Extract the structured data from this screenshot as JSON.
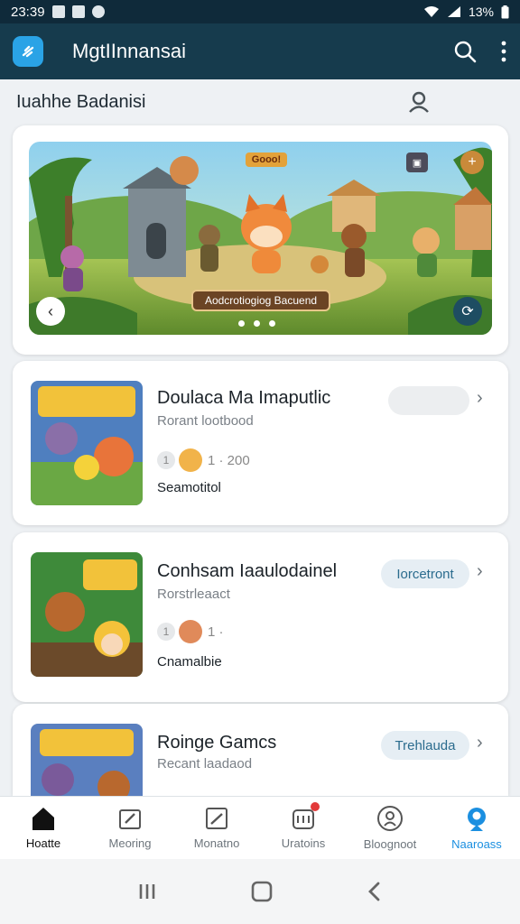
{
  "status_bar": {
    "time": "23:39",
    "battery": "13%"
  },
  "app_bar": {
    "title": "MgtIInnansai"
  },
  "subheader": {
    "title": "Iuahhe  Badanisi"
  },
  "banner": {
    "badge": "Gooo!",
    "label": "Aodcrotiogiog Bacuend",
    "dots": 3
  },
  "games": [
    {
      "title": "Doulaca Ma Imaputlic",
      "subtitle": "Rorant lootbood",
      "counts": "1 · 200",
      "meta": "Seamotitol",
      "action": ""
    },
    {
      "title": "Conhsam Iaaulodainel",
      "subtitle": "Rorstrleaact",
      "counts": "1 ·",
      "meta": "Cnamalbie",
      "action": "Iorcetront"
    },
    {
      "title": "Roinge Gamcs",
      "subtitle": "Recant laadaod",
      "counts": "",
      "meta": "",
      "action": "Trehlauda"
    }
  ],
  "bottom_nav": [
    {
      "label": "Hoatte",
      "icon": "home-icon"
    },
    {
      "label": "Meoring",
      "icon": "edit-icon"
    },
    {
      "label": "Monatno",
      "icon": "chart-icon"
    },
    {
      "label": "Uratoins",
      "icon": "inbox-icon"
    },
    {
      "label": "Bloognoot",
      "icon": "user-circle-icon"
    },
    {
      "label": "Naaroass",
      "icon": "profile-icon"
    }
  ],
  "colors": {
    "appbar": "#163b4d",
    "accent": "#1b8fe0",
    "status_bg": "#0f2a3a"
  }
}
